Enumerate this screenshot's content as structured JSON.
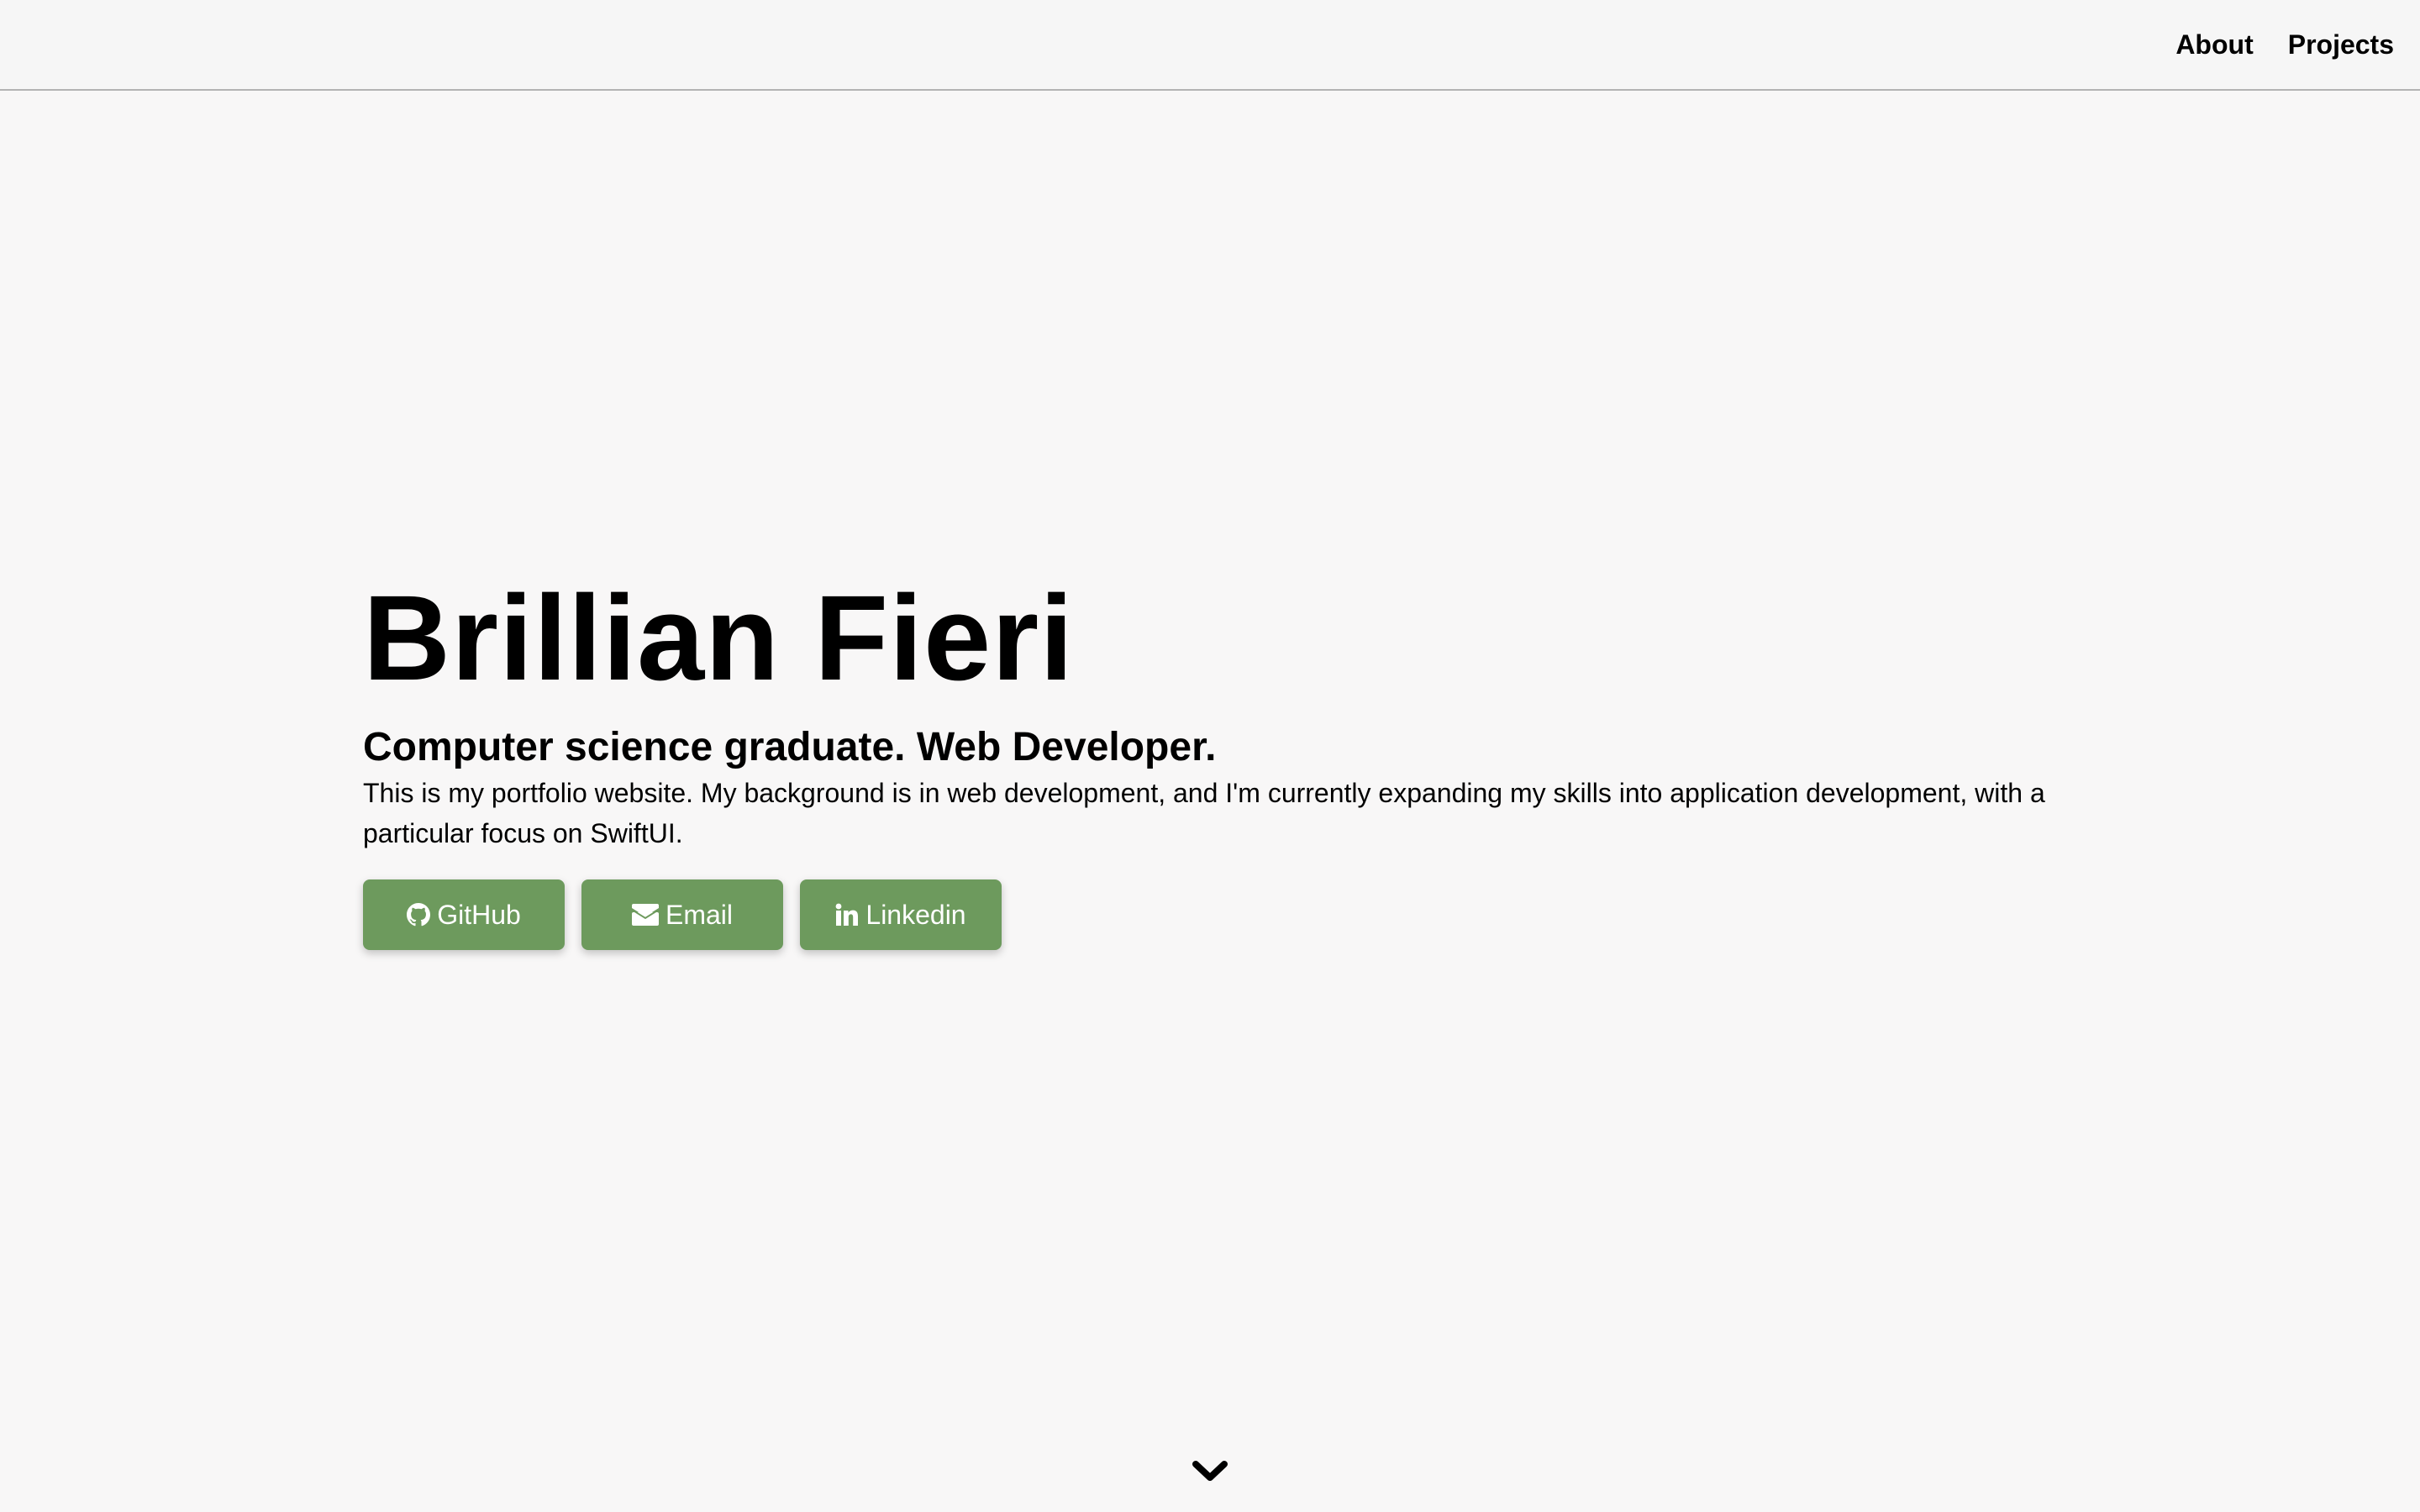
{
  "nav": {
    "links": [
      {
        "label": "About"
      },
      {
        "label": "Projects"
      }
    ]
  },
  "hero": {
    "name": "Brillian Fieri",
    "subtitle": "Computer science graduate. Web Developer.",
    "description": "This is my portfolio website. My background is in web development, and I'm currently expanding my skills into application development, with a particular focus on SwiftUI.",
    "buttons": [
      {
        "label": "GitHub",
        "icon": "github-icon"
      },
      {
        "label": "Email",
        "icon": "envelope-icon"
      },
      {
        "label": "Linkedin",
        "icon": "linkedin-icon"
      }
    ]
  },
  "scroll_indicator": {
    "icon": "chevron-down-icon"
  },
  "colors": {
    "background": "#f8f7f7",
    "navbar_background": "#f6f6f6",
    "button_background": "#6d9a5d",
    "button_text": "#ffffff",
    "text": "#000000"
  }
}
